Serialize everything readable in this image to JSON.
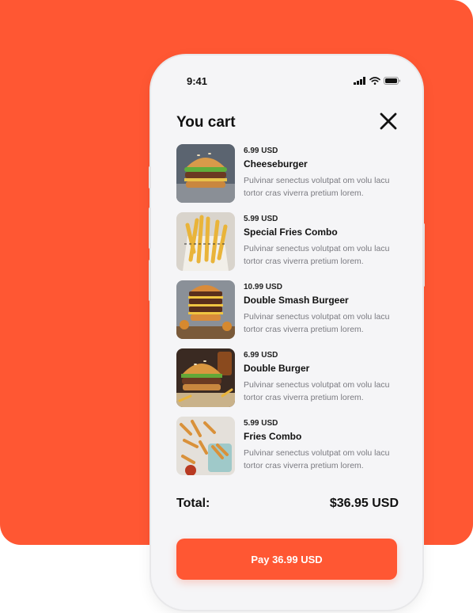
{
  "status_bar": {
    "time": "9:41"
  },
  "header": {
    "title": "You cart",
    "close_icon": "close-icon"
  },
  "cart": {
    "items": [
      {
        "price": "6.99 USD",
        "name": "Cheeseburger",
        "description": "Pulvinar senectus volutpat om volu lacu tortor cras viverra pretium lorem.",
        "image": "cheeseburger-photo"
      },
      {
        "price": "5.99 USD",
        "name": "Special Fries Combo",
        "description": "Pulvinar senectus volutpat om volu lacu tortor cras viverra pretium lorem.",
        "image": "fries-photo"
      },
      {
        "price": "10.99 USD",
        "name": "Double Smash Burgeer",
        "description": "Pulvinar senectus volutpat om volu lacu tortor cras viverra pretium lorem.",
        "image": "smash-burger-photo"
      },
      {
        "price": "6.99 USD",
        "name": "Double Burger",
        "description": "Pulvinar senectus volutpat om volu lacu tortor cras viverra pretium lorem.",
        "image": "double-burger-photo"
      },
      {
        "price": "5.99 USD",
        "name": "Fries Combo",
        "description": "Pulvinar senectus volutpat om volu lacu tortor cras viverra pretium lorem.",
        "image": "fries-combo-photo"
      }
    ]
  },
  "total": {
    "label": "Total:",
    "value": "$36.95 USD"
  },
  "pay_button": {
    "label": "Pay 36.99 USD"
  },
  "colors": {
    "accent": "#FF5733",
    "background": "#F5F5F7",
    "text": "#111111",
    "muted": "#7A7A80"
  }
}
